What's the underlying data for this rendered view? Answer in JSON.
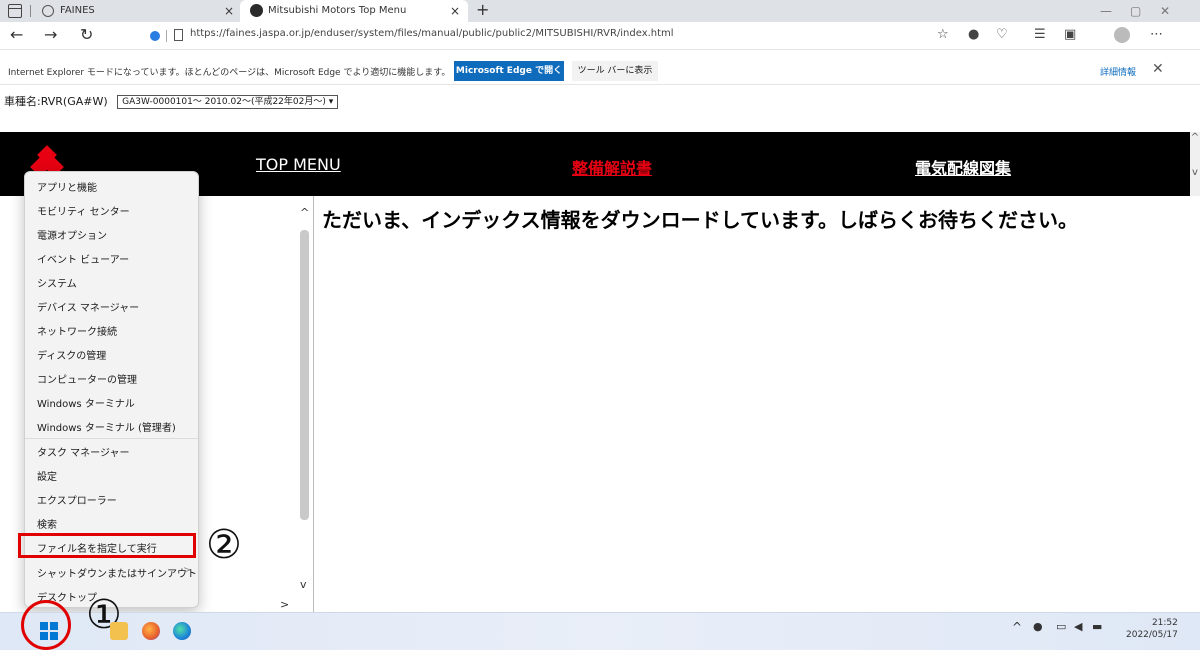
{
  "browser": {
    "tabs": [
      {
        "label": "FAINES",
        "close": "×"
      },
      {
        "label": "Mitsubishi Motors Top Menu",
        "close": "×"
      }
    ],
    "new_tab": "+",
    "url": "https://faines.jaspa.or.jp/enduser/system/files/manual/public/public2/MITSUBISHI/RVR/index.html",
    "window_controls": [
      "—",
      "▢",
      "✕"
    ]
  },
  "ie_bar": {
    "message": "Internet Explorer モードになっています。ほとんどのページは、Microsoft Edge でより適切に機能します。",
    "open_in_edge": "Microsoft Edge で開く",
    "show_in_toolbar": "ツール バーに表示",
    "more_info": "詳細情報",
    "close": "✕"
  },
  "vehicle": {
    "label": "車種名:RVR(GA#W)",
    "selected": "GA3W-0000101～ 2010.02～(平成22年02月～)",
    "chevron": "▾"
  },
  "header": {
    "top_menu": "TOP MENU",
    "seibi": "整備解説書",
    "denki": "電気配線図集"
  },
  "main": {
    "loading_text": "ただいま、インデックス情報をダウンロードしています。しばらくお待ちください。"
  },
  "context_menu": {
    "items": [
      "アプリと機能",
      "モビリティ センター",
      "電源オプション",
      "イベント ビューアー",
      "システム",
      "デバイス マネージャー",
      "ネットワーク接続",
      "ディスクの管理",
      "コンピューターの管理",
      "Windows ターミナル",
      "Windows ターミナル (管理者)",
      "タスク マネージャー",
      "設定",
      "エクスプローラー",
      "検索",
      "ファイル名を指定して実行",
      "シャットダウンまたはサインアウト",
      "デスクトップ"
    ],
    "submenu_chevron": ">"
  },
  "annotations": {
    "step1": "①",
    "step2": "②"
  },
  "taskbar": {
    "time": "21:52",
    "date": "2022/05/17",
    "tray_chevron": "^"
  },
  "colors": {
    "accent_red": "#e60012",
    "edge_blue": "#0f6cbd",
    "highlight_red": "#e00000",
    "header_black": "#000000"
  }
}
